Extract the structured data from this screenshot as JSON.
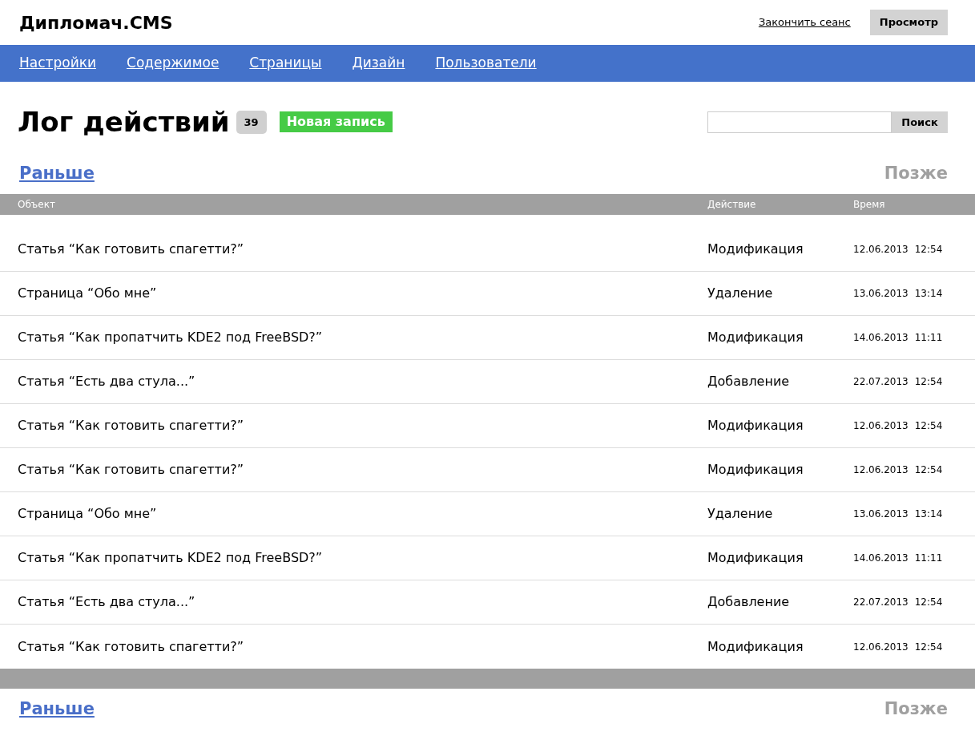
{
  "header": {
    "logo": "Дипломач.CMS",
    "logout": "Закончить сеанс",
    "preview": "Просмотр"
  },
  "nav": [
    {
      "label": "Настройки"
    },
    {
      "label": "Содержимое"
    },
    {
      "label": "Страницы"
    },
    {
      "label": "Дизайн"
    },
    {
      "label": "Пользователи"
    }
  ],
  "page": {
    "title": "Лог действий",
    "count": "39",
    "new_button": "Новая запись"
  },
  "search": {
    "button": "Поиск"
  },
  "pager_top": [
    {
      "label": "Раньше",
      "disabled": false
    },
    {
      "label": "Позже",
      "disabled": true
    }
  ],
  "table": {
    "columns": [
      "Объект",
      "Действие",
      "Время"
    ],
    "rows": [
      {
        "object": "Статья “Как готовить спагетти?”",
        "action": "Модификация",
        "date": "12.06.2013",
        "time": "12:54"
      },
      {
        "object": "Страница “Обо мне”",
        "action": "Удаление",
        "date": "13.06.2013",
        "time": "13:14"
      },
      {
        "object": "Статья “Как пропатчить KDE2 под FreeBSD?”",
        "action": "Модификация",
        "date": "14.06.2013",
        "time": "11:11"
      },
      {
        "object": "Статья “Есть два стула...”",
        "action": "Добавление",
        "date": "22.07.2013",
        "time": "12:54"
      },
      {
        "object": "Статья “Как готовить спагетти?”",
        "action": "Модификация",
        "date": "12.06.2013",
        "time": "12:54"
      },
      {
        "object": "Статья “Как готовить спагетти?”",
        "action": "Модификация",
        "date": "12.06.2013",
        "time": "12:54"
      },
      {
        "object": "Страница “Обо мне”",
        "action": "Удаление",
        "date": "13.06.2013",
        "time": "13:14"
      },
      {
        "object": "Статья “Как пропатчить KDE2 под FreeBSD?”",
        "action": "Модификация",
        "date": "14.06.2013",
        "time": "11:11"
      },
      {
        "object": "Статья “Есть два стула...”",
        "action": "Добавление",
        "date": "22.07.2013",
        "time": "12:54"
      },
      {
        "object": "Статья “Как готовить спагетти?”",
        "action": "Модификация",
        "date": "12.06.2013",
        "time": "12:54"
      }
    ]
  },
  "pager_bottom": [
    {
      "label": "Раньше",
      "disabled": false
    },
    {
      "label": "Позже",
      "disabled": true
    }
  ]
}
